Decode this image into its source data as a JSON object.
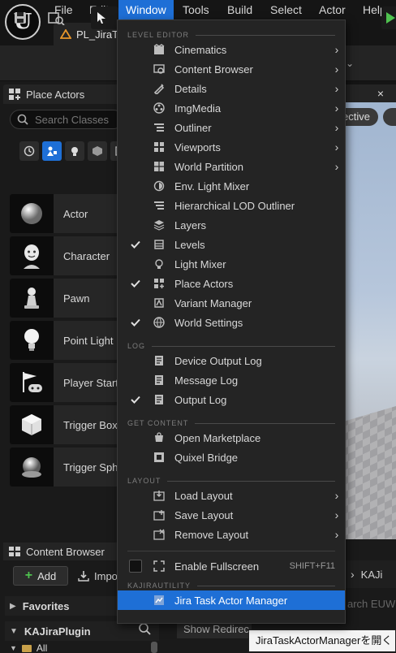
{
  "menubar": {
    "items": [
      "File",
      "Edit",
      "Window",
      "Tools",
      "Build",
      "Select",
      "Actor",
      "Help"
    ],
    "active": "Window"
  },
  "doc_tab": {
    "label": "PL_JiraT"
  },
  "left_panel": {
    "title": "Place Actors",
    "search_placeholder": "Search Classes",
    "actors": [
      {
        "label": "Actor",
        "icon": "sphere-icon"
      },
      {
        "label": "Character",
        "icon": "character-icon"
      },
      {
        "label": "Pawn",
        "icon": "pawn-icon"
      },
      {
        "label": "Point Light",
        "icon": "light-bulb-icon"
      },
      {
        "label": "Player Start",
        "icon": "player-start-icon"
      },
      {
        "label": "Trigger Box",
        "icon": "trigger-box-icon"
      },
      {
        "label": "Trigger Sphere",
        "icon": "trigger-sphere-icon"
      }
    ]
  },
  "viewport": {
    "perspective_label": "ective",
    "close": "×"
  },
  "content_browser": {
    "title": "Content Browser",
    "add_label": "Add",
    "import_label": "Impo",
    "favorites": "Favorites",
    "plugin": "KAJiraPlugin",
    "all": "All",
    "breadcrumb": "KAJi",
    "search_placeholder": "arch EUW",
    "show_redirect": "Show Redirec"
  },
  "tooltip": {
    "text": "JiraTaskActorManagerを開く"
  },
  "window_menu": {
    "sections": [
      {
        "header": "LEVEL EDITOR",
        "items": [
          {
            "label": "Cinematics",
            "icon": "cinematics-icon",
            "submenu": true,
            "checked": false
          },
          {
            "label": "Content Browser",
            "icon": "content-browser-icon",
            "submenu": true,
            "checked": false
          },
          {
            "label": "Details",
            "icon": "details-icon",
            "submenu": true,
            "checked": false
          },
          {
            "label": "ImgMedia",
            "icon": "imgmedia-icon",
            "submenu": true,
            "checked": false
          },
          {
            "label": "Outliner",
            "icon": "outliner-icon",
            "submenu": true,
            "checked": false
          },
          {
            "label": "Viewports",
            "icon": "viewports-icon",
            "submenu": true,
            "checked": false
          },
          {
            "label": "World Partition",
            "icon": "world-partition-icon",
            "submenu": true,
            "checked": false
          },
          {
            "label": "Env. Light Mixer",
            "icon": "env-light-mixer-icon",
            "submenu": false,
            "checked": false
          },
          {
            "label": "Hierarchical LOD Outliner",
            "icon": "hlod-outliner-icon",
            "submenu": false,
            "checked": false
          },
          {
            "label": "Layers",
            "icon": "layers-icon",
            "submenu": false,
            "checked": false
          },
          {
            "label": "Levels",
            "icon": "levels-icon",
            "submenu": false,
            "checked": true
          },
          {
            "label": "Light Mixer",
            "icon": "light-mixer-icon",
            "submenu": false,
            "checked": false
          },
          {
            "label": "Place Actors",
            "icon": "place-actors-icon",
            "submenu": false,
            "checked": true
          },
          {
            "label": "Variant Manager",
            "icon": "variant-manager-icon",
            "submenu": false,
            "checked": false
          },
          {
            "label": "World Settings",
            "icon": "world-settings-icon",
            "submenu": false,
            "checked": true
          }
        ]
      },
      {
        "header": "LOG",
        "items": [
          {
            "label": "Device Output Log",
            "icon": "log-icon",
            "submenu": false,
            "checked": false
          },
          {
            "label": "Message Log",
            "icon": "log-icon",
            "submenu": false,
            "checked": false
          },
          {
            "label": "Output Log",
            "icon": "log-icon",
            "submenu": false,
            "checked": true
          }
        ]
      },
      {
        "header": "GET CONTENT",
        "items": [
          {
            "label": "Open Marketplace",
            "icon": "marketplace-icon",
            "submenu": false,
            "checked": false
          },
          {
            "label": "Quixel Bridge",
            "icon": "quixel-bridge-icon",
            "submenu": false,
            "checked": false
          }
        ]
      },
      {
        "header": "LAYOUT",
        "items": [
          {
            "label": "Load Layout",
            "icon": "load-layout-icon",
            "submenu": true,
            "checked": false
          },
          {
            "label": "Save Layout",
            "icon": "save-layout-icon",
            "submenu": true,
            "checked": false
          },
          {
            "label": "Remove Layout",
            "icon": "remove-layout-icon",
            "submenu": true,
            "checked": false
          }
        ]
      }
    ],
    "fullscreen": {
      "label": "Enable Fullscreen",
      "shortcut": "SHIFT+F11",
      "icon": "fullscreen-icon"
    },
    "kaji": {
      "header": "KAJIRAUTILITY",
      "label": "Jira Task Actor Manager",
      "icon": "jira-task-icon"
    }
  },
  "colors": {
    "accent": "#1e6fd6",
    "menu_bg": "#242424",
    "panel_bg": "#1a1a1a"
  }
}
